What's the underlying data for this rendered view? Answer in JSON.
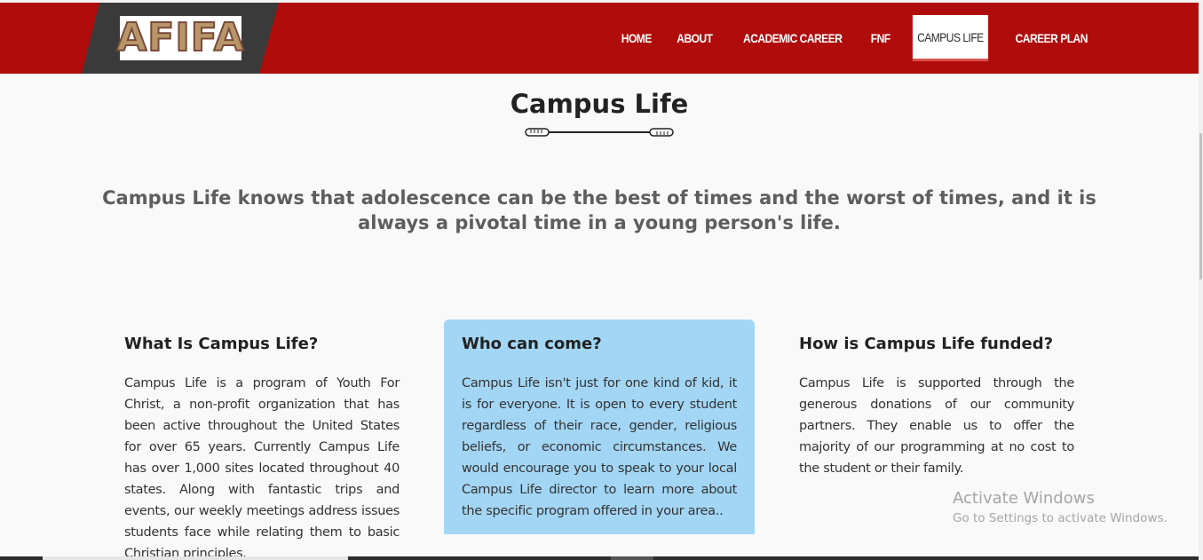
{
  "header": {
    "logo_text": "AFIFA",
    "nav": [
      {
        "label": "HOME"
      },
      {
        "label": "ABOUT"
      },
      {
        "label": "ACADEMIC CAREER"
      },
      {
        "label": "FNF"
      },
      {
        "label": "CAMPUS LIFE",
        "active": true
      },
      {
        "label": "CAREER PLAN"
      }
    ]
  },
  "colors": {
    "header_bg": "#b10c0c",
    "logo_band": "#3a3a3a",
    "highlight_card": "#a3d6f5"
  },
  "main": {
    "title": "Campus Life",
    "intro": "Campus Life knows that adolescence can be the best of times and the worst of times, and it is always a pivotal time in a young person's life.",
    "columns": [
      {
        "title": "What Is Campus Life?",
        "text": "Campus Life is a program of Youth For Christ, a non-profit organization that has been active throughout the United States for over 65 years. Currently Campus Life has over 1,000 sites located throughout 40 states. Along with fantastic trips and events, our weekly meetings address issues students face while relating them to basic Christian principles."
      },
      {
        "title": "Who can come?",
        "text": "Campus Life isn't just for one kind of kid, it is for everyone. It is open to every student regardless of their race, gender, religious beliefs, or economic circumstances. We would encourage you to speak to your local Campus Life director to learn more about the specific program offered in your area.."
      },
      {
        "title": "How is Campus Life funded?",
        "text": "Campus Life is supported through the generous donations of our community partners. They enable us to offer the majority of our programming at no cost to the student or their family."
      }
    ]
  },
  "watermark": {
    "title": "Activate Windows",
    "subtitle": "Go to Settings to activate Windows."
  }
}
